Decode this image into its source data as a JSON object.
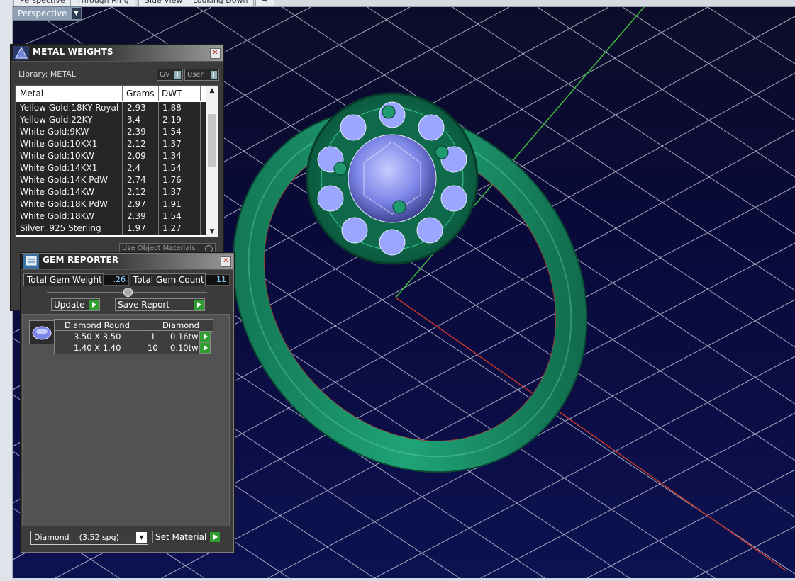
{
  "tabs": [
    "Perspective",
    "Through Ring",
    "Side View",
    "Looking Down",
    "+"
  ],
  "viewport": {
    "view_menu_label": "Perspective"
  },
  "metal_weights": {
    "title": "METAL WEIGHTS",
    "library_label": "Library: METAL",
    "gv_label": "GV",
    "user_label": "User",
    "toggle_glyph": "I",
    "columns": [
      "Metal",
      "Grams",
      "DWT"
    ],
    "rows": [
      [
        "Yellow Gold:18KY Royal",
        "2.93",
        "1.88"
      ],
      [
        "Yellow Gold:22KY",
        "3.4",
        "2.19"
      ],
      [
        "White Gold:9KW",
        "2.39",
        "1.54"
      ],
      [
        "White Gold:10KX1",
        "2.12",
        "1.37"
      ],
      [
        "White Gold:10KW",
        "2.09",
        "1.34"
      ],
      [
        "White Gold:14KX1",
        "2.4",
        "1.54"
      ],
      [
        "White Gold:14K PdW",
        "2.74",
        "1.76"
      ],
      [
        "White Gold:14KW",
        "2.12",
        "1.37"
      ],
      [
        "White Gold:18K PdW",
        "2.97",
        "1.91"
      ],
      [
        "White Gold:18KW",
        "2.39",
        "1.54"
      ],
      [
        "Silver:.925 Sterling",
        "1.97",
        "1.27"
      ]
    ],
    "use_object_materials": "Use Object Materials"
  },
  "gem_reporter": {
    "title": "GEM REPORTER",
    "total_weight_label": "Total Gem Weight",
    "total_weight_value": ".26",
    "total_count_label": "Total Gem Count",
    "total_count_value": "11",
    "update_label": "Update",
    "save_report_label": "Save Report",
    "header": {
      "shape": "Diamond Round",
      "material": "Diamond"
    },
    "gems": [
      {
        "size": "3.50 X 3.50",
        "count": "1",
        "weight": "0.16tw"
      },
      {
        "size": "1.40 X 1.40",
        "count": "10",
        "weight": "0.10tw"
      }
    ],
    "material_select": "Diamond    (3.52 spg)",
    "set_material_label": "Set Material"
  },
  "colors": {
    "metal": "#1f9a6e",
    "gem": "#9aa6ff",
    "grid": "#d8dde8",
    "background": "#0a0a3a",
    "accent_green": "#2f9d2f"
  }
}
